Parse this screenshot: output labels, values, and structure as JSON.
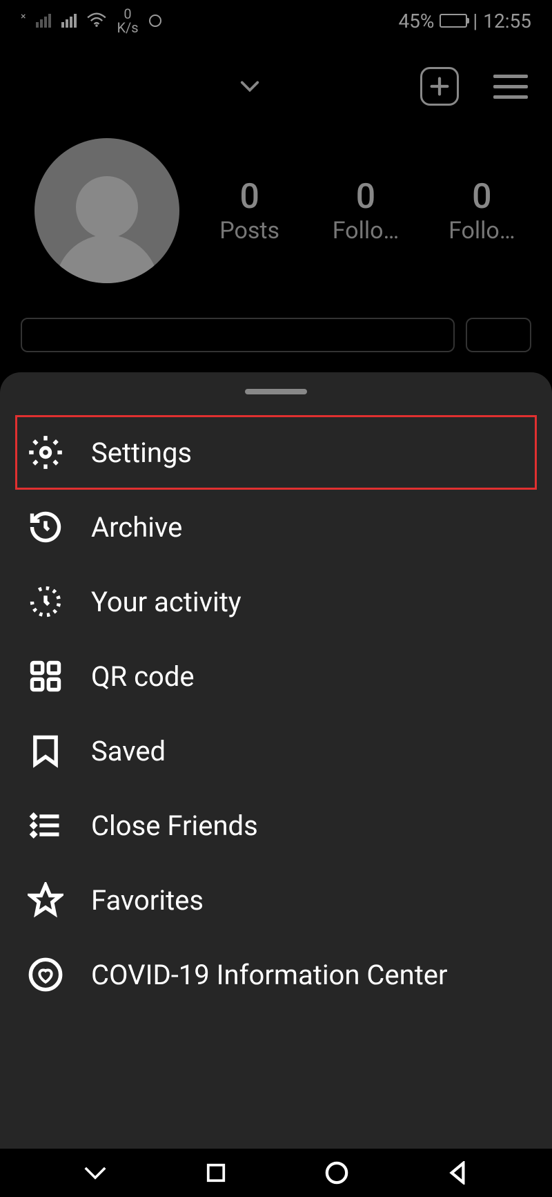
{
  "status_bar": {
    "data_rate_top": "0",
    "data_rate_bottom": "K/s",
    "battery_percent": "45%",
    "time": "12:55"
  },
  "profile": {
    "stats": {
      "posts": {
        "value": "0",
        "label": "Posts"
      },
      "followers": {
        "value": "0",
        "label": "Follo…"
      },
      "following": {
        "value": "0",
        "label": "Follo…"
      }
    }
  },
  "menu": {
    "items": [
      {
        "id": "settings",
        "label": "Settings",
        "highlighted": true
      },
      {
        "id": "archive",
        "label": "Archive"
      },
      {
        "id": "your-activity",
        "label": "Your activity"
      },
      {
        "id": "qr-code",
        "label": "QR code"
      },
      {
        "id": "saved",
        "label": "Saved"
      },
      {
        "id": "close-friends",
        "label": "Close Friends"
      },
      {
        "id": "favorites",
        "label": "Favorites"
      },
      {
        "id": "covid-info",
        "label": "COVID-19 Information Center"
      }
    ]
  }
}
